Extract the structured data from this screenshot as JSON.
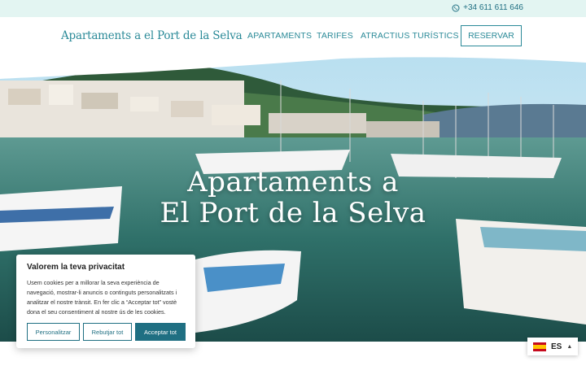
{
  "topbar": {
    "phone": "+34 611 611 646",
    "phone_icon": "whatsapp-icon"
  },
  "header": {
    "logo": "Apartaments a el Port de la Selva",
    "nav": [
      "APARTAMENTS",
      "TARIFES",
      "ATRACTIUS TURÍSTICS"
    ],
    "cta": "RESERVAR"
  },
  "hero": {
    "title_line1": "Apartaments a",
    "title_line2": "El Port de la Selva"
  },
  "cookie": {
    "title": "Valorem la teva privacitat",
    "text": "Usem cookies per a millorar la seva experiència de navegació, mostrar-li anuncis o continguts personalitzats i analitzar el nostre trànsit. En fer clic a “Acceptar tot” vostè dona el seu consentiment al nostre ús de les cookies.",
    "buttons": [
      "Personalitzar",
      "Rebutjar tot",
      "Acceptar tot"
    ]
  },
  "language": {
    "code": "ES",
    "flag": "spain-flag-icon"
  },
  "colors": {
    "accent": "#2b8a98",
    "topbar_bg": "#e3f5f2",
    "button_dark": "#1f6f82"
  }
}
